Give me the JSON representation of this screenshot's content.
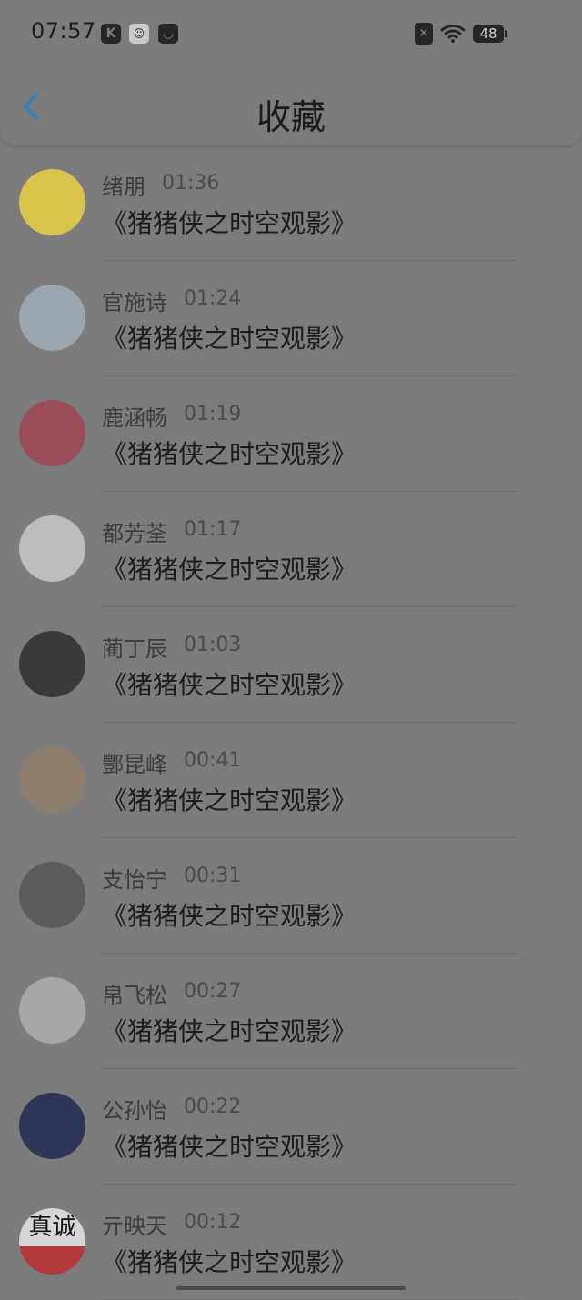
{
  "status_bar": {
    "time": "07:57",
    "battery": "48",
    "icons": [
      "k-app-icon",
      "smiley-app-icon",
      "bag-app-icon",
      "sim-off-icon",
      "wifi-icon",
      "battery-icon"
    ]
  },
  "header": {
    "title": "收藏",
    "back_icon": "chevron-left-icon",
    "accent_color": "#2f7fc1"
  },
  "favorites": [
    {
      "name": "绪朋",
      "time": "01:36",
      "title": "《猪猪侠之时空观影》",
      "avatar_color": "#d8c34c"
    },
    {
      "name": "官施诗",
      "time": "01:24",
      "title": "《猪猪侠之时空观影》",
      "avatar_color": "#9aa7b0"
    },
    {
      "name": "鹿涵畅",
      "time": "01:19",
      "title": "《猪猪侠之时空观影》",
      "avatar_color": "#9a4d56"
    },
    {
      "name": "都芳荃",
      "time": "01:17",
      "title": "《猪猪侠之时空观影》",
      "avatar_color": "#bcbcbc"
    },
    {
      "name": "蔺丁辰",
      "time": "01:03",
      "title": "《猪猪侠之时空观影》",
      "avatar_color": "#3a3a3a"
    },
    {
      "name": "酆昆峰",
      "time": "00:41",
      "title": "《猪猪侠之时空观影》",
      "avatar_color": "#8f7e6e"
    },
    {
      "name": "支怡宁",
      "time": "00:31",
      "title": "《猪猪侠之时空观影》",
      "avatar_color": "#5b5b5b"
    },
    {
      "name": "帛飞松",
      "time": "00:27",
      "title": "《猪猪侠之时空观影》",
      "avatar_color": "#a7a7a7"
    },
    {
      "name": "公孙怡",
      "time": "00:22",
      "title": "《猪猪侠之时空观影》",
      "avatar_color": "#2c3656"
    },
    {
      "name": "亓映天",
      "time": "00:12",
      "title": "《猪猪侠之时空观影》",
      "avatar_color": "#b23a3a",
      "avatar_text": "真诚"
    }
  ]
}
